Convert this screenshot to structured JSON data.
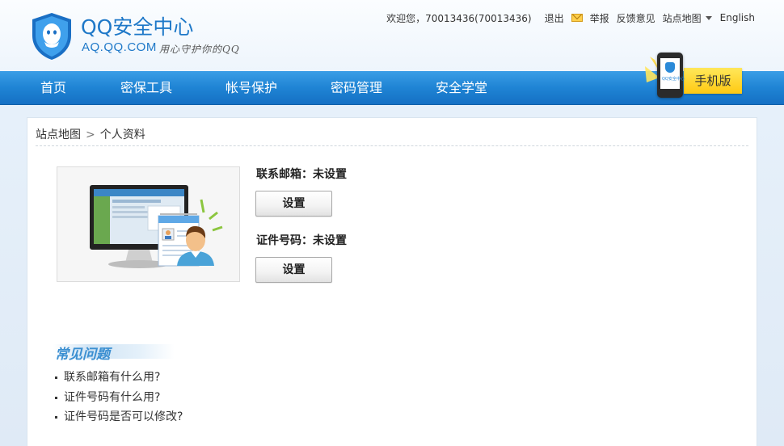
{
  "header": {
    "brand_name": "QQ安全中心",
    "brand_domain": "AQ.QQ.COM",
    "brand_slogan": "用心守护你的QQ",
    "welcome": "欢迎您，70013436(70013436)",
    "logout": "退出",
    "report": "举报",
    "feedback": "反馈意见",
    "sitemap": "站点地图",
    "language": "English",
    "icons": [
      "qq-shield-icon",
      "mail-icon",
      "caret-down-icon"
    ]
  },
  "nav": {
    "items": [
      "首页",
      "密保工具",
      "帐号保护",
      "密码管理",
      "安全学堂"
    ],
    "mobile_label": "手机版",
    "mobile_screen_text": "QQ安全中心"
  },
  "breadcrumb": {
    "root": "站点地图",
    "separator": ">",
    "current": "个人资料"
  },
  "profile": {
    "email_label": "联系邮箱：未设置",
    "email_button": "设置",
    "id_label": "证件号码：未设置",
    "id_button": "设置"
  },
  "faq": {
    "title": "常见问题",
    "items": [
      "联系邮箱有什么用?",
      "证件号码有什么用?",
      "证件号码是否可以修改?"
    ]
  },
  "colors": {
    "brand_blue": "#1e78c8",
    "nav_blue": "#1f84d4",
    "mobile_yellow": "#ffd42a"
  }
}
